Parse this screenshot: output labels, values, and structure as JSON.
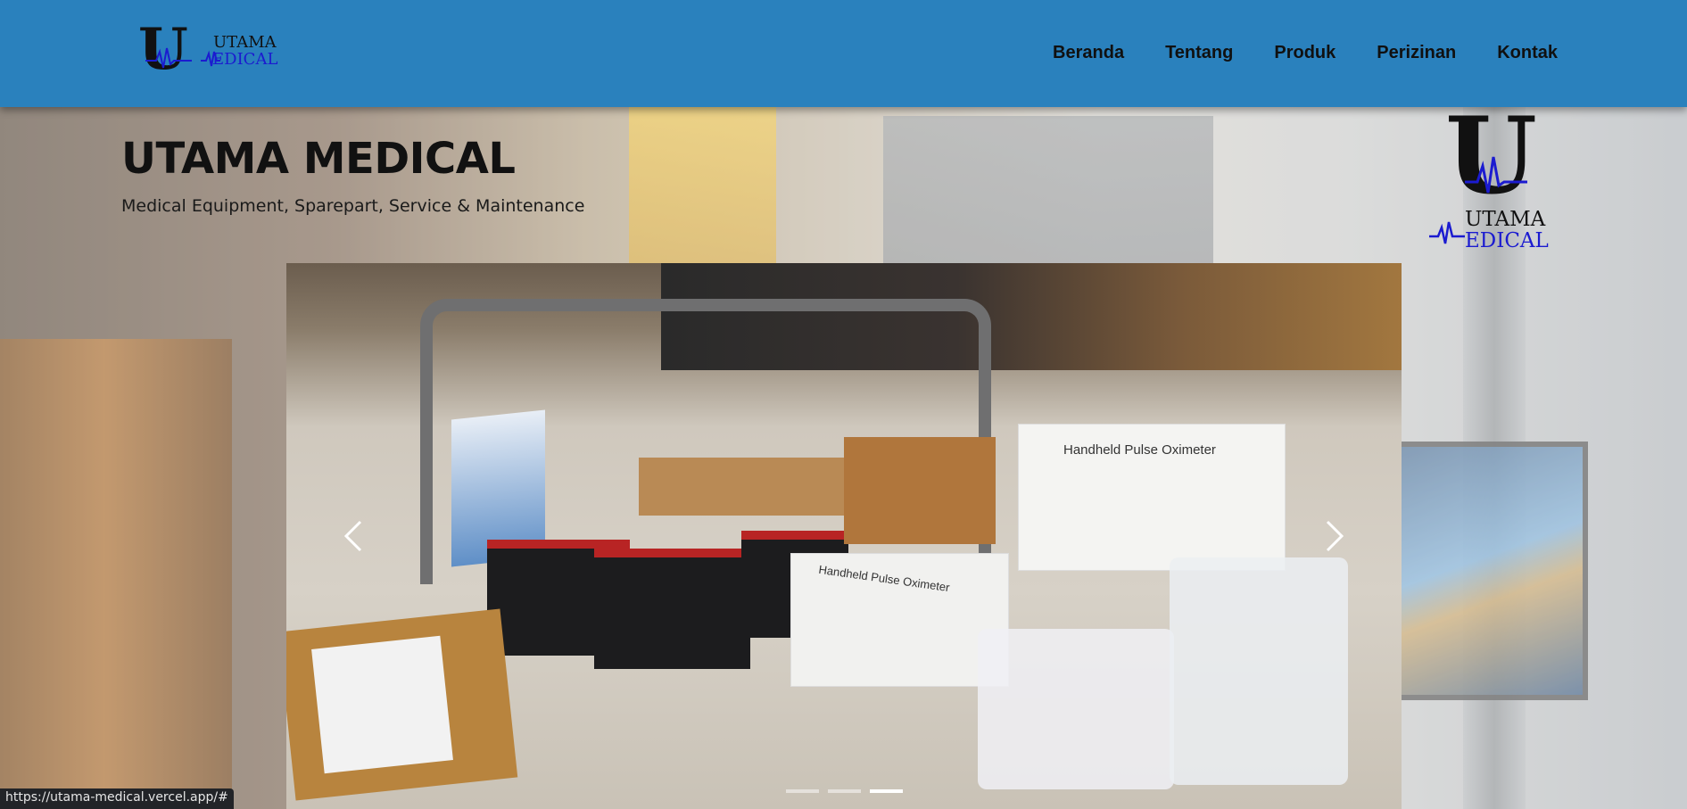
{
  "brand": {
    "letter": "U",
    "name_top": "UTAMA",
    "name_bottom": "EDICAL"
  },
  "nav": {
    "items": [
      "Beranda",
      "Tentang",
      "Produk",
      "Perizinan",
      "Kontak"
    ]
  },
  "hero": {
    "title": "UTAMA MEDICAL",
    "subtitle": "Medical Equipment, Sparepart, Service & Maintenance"
  },
  "carousel": {
    "product_label_1": "Handheld Pulse Oximeter",
    "product_label_2": "Handheld Pulse Oximeter",
    "prev_icon": "chevron-left-icon",
    "next_icon": "chevron-right-icon",
    "slide_count": 3,
    "active_index": 2
  },
  "status_url": "https://utama-medical.vercel.app/#",
  "colors": {
    "navbar": "#2a81bd",
    "brand_blue": "#1b1bd0",
    "nav_text": "#101010"
  }
}
